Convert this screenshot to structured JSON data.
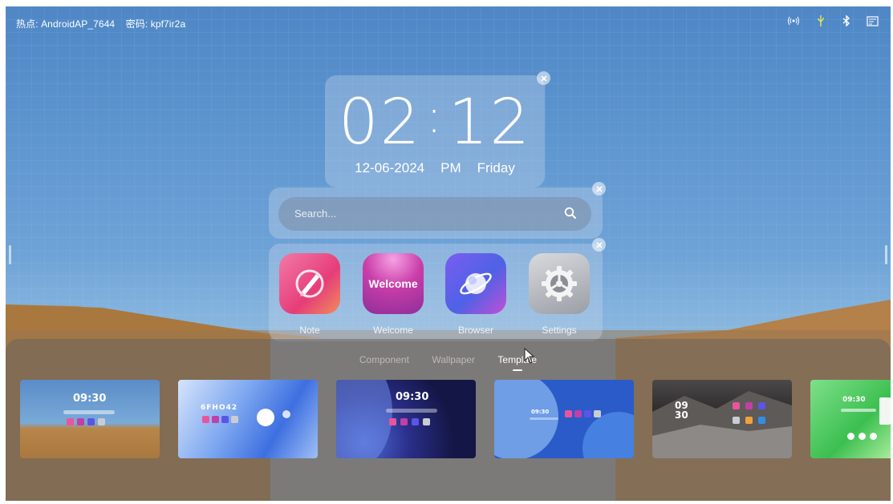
{
  "status_bar": {
    "hotspot_label": "热点: AndroidAP_7644",
    "password_label": "密码: kpf7ir2a",
    "icons": [
      "hotspot-icon",
      "usb-icon",
      "bluetooth-icon",
      "screen-cast-icon"
    ]
  },
  "clock_widget": {
    "hours": "02",
    "separator": ":",
    "minutes": "12",
    "date": "12-06-2024",
    "meridiem": "PM",
    "weekday": "Friday"
  },
  "search_widget": {
    "placeholder": "Search..."
  },
  "apps": [
    {
      "label": "Note",
      "icon": "note-pen-icon",
      "color": "#e9559c"
    },
    {
      "label": "Welcome",
      "icon": "welcome-icon",
      "icon_text": "Welcome",
      "color": "#c23ea8"
    },
    {
      "label": "Browser",
      "icon": "planet-icon",
      "color": "#5a55e6"
    },
    {
      "label": "Settings",
      "icon": "gear-icon",
      "color": "#b9bcc2"
    }
  ],
  "panel": {
    "tabs": [
      {
        "label": "Component",
        "active": false
      },
      {
        "label": "Wallpaper",
        "active": false
      },
      {
        "label": "Template",
        "active": true
      }
    ],
    "templates": [
      {
        "name": "template-desert",
        "time": "09:30"
      },
      {
        "name": "template-blue-glass",
        "time": "6FHO42"
      },
      {
        "name": "template-dark-wave",
        "time": "09:30"
      },
      {
        "name": "template-blue-circles",
        "time": "09:30"
      },
      {
        "name": "template-dark-mountain",
        "time": "09\n30"
      },
      {
        "name": "template-green",
        "time": "09:30"
      }
    ]
  },
  "colors": {
    "sky_top": "#4f87c6",
    "sand": "#b8864a",
    "panel": "#69645f"
  }
}
